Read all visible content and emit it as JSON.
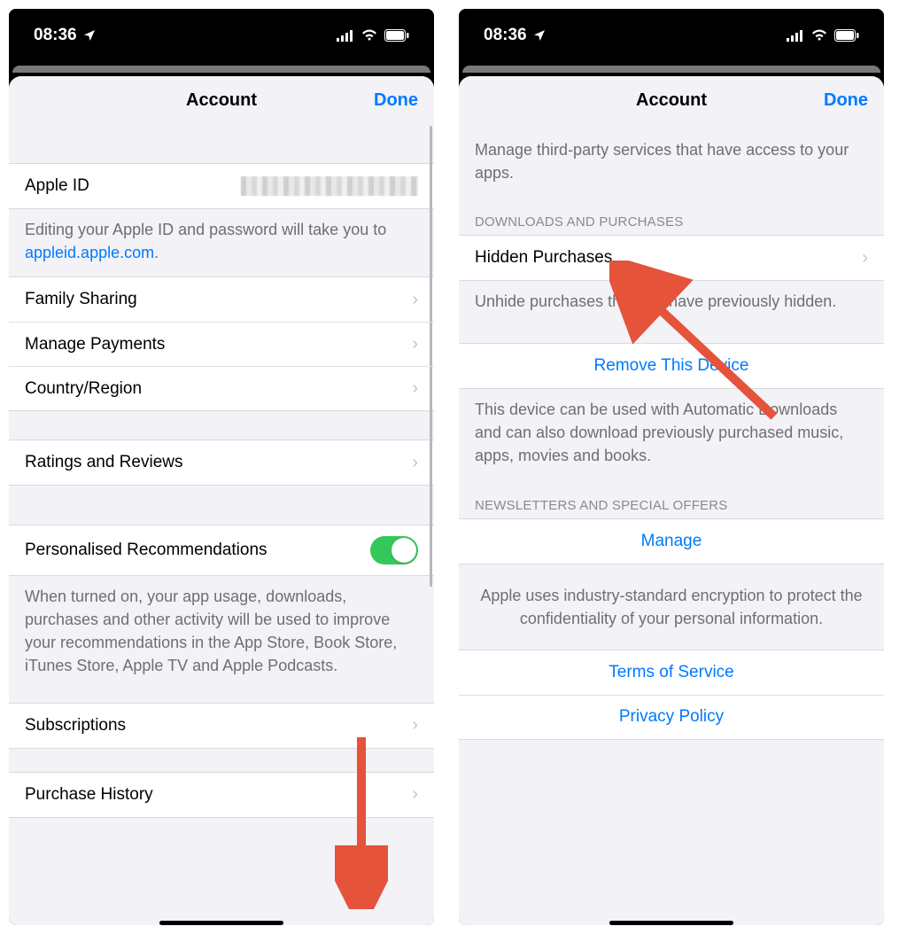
{
  "statusbar": {
    "time": "08:36"
  },
  "left": {
    "nav": {
      "title": "Account",
      "done": "Done"
    },
    "appleid_row": {
      "label": "Apple ID"
    },
    "appleid_footer_prefix": "Editing your Apple ID and password will take you to ",
    "appleid_footer_link": "appleid.apple.com",
    "appleid_footer_suffix": ".",
    "rows1": [
      {
        "label": "Family Sharing"
      },
      {
        "label": "Manage Payments"
      },
      {
        "label": "Country/Region"
      }
    ],
    "ratings_row": {
      "label": "Ratings and Reviews"
    },
    "personalised_row": {
      "label": "Personalised Recommendations"
    },
    "personalised_footer": "When turned on, your app usage, downloads, purchases and other activity will be used to improve your recommendations in the App Store, Book Store, iTunes Store, Apple TV and Apple Podcasts.",
    "subs_row": {
      "label": "Subscriptions"
    },
    "history_row": {
      "label": "Purchase History"
    }
  },
  "right": {
    "nav": {
      "title": "Account",
      "done": "Done"
    },
    "top_footer": "Manage third-party services that have access to your apps.",
    "downloads_header": "DOWNLOADS AND PURCHASES",
    "hidden_row": {
      "label": "Hidden Purchases"
    },
    "hidden_footer": "Unhide purchases that you have previously hidden.",
    "remove_device": "Remove This Device",
    "remove_footer": "This device can be used with Automatic Downloads and can also download previously purchased music, apps, movies and books.",
    "newsletters_header": "NEWSLETTERS AND SPECIAL OFFERS",
    "manage": "Manage",
    "encryption": "Apple uses industry-standard encryption to protect the confidentiality of your personal information.",
    "terms": "Terms of Service",
    "privacy": "Privacy Policy"
  }
}
